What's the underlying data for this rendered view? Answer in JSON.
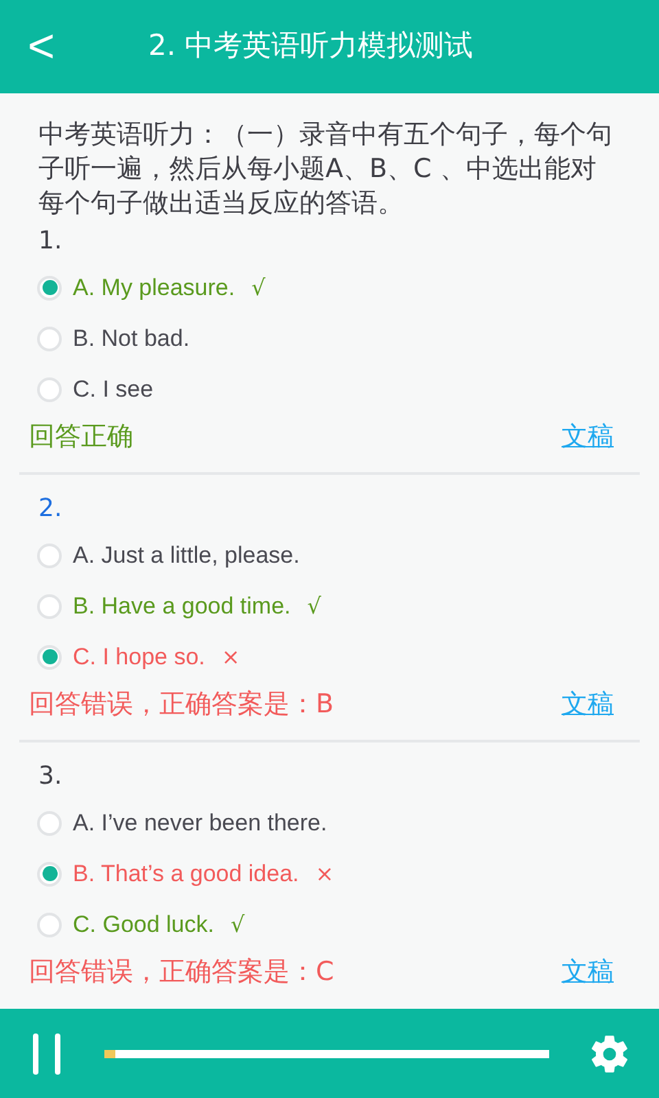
{
  "header": {
    "back": "<",
    "title": "2. 中考英语听力模拟测试"
  },
  "instructions": "中考英语听力：（一）录音中有五个句子，每个句子听一遍，然后从每小题A、B、C 、中选出能对每个句子做出适当反应的答语。",
  "questions": [
    {
      "number": "1.",
      "playing": false,
      "options": [
        {
          "label": "A. My pleasure.",
          "mark": "√",
          "selected": true,
          "answer": true
        },
        {
          "label": "B. Not bad.",
          "selected": false,
          "answer": false
        },
        {
          "label": "C. I see",
          "selected": false,
          "answer": false
        }
      ],
      "result": {
        "text": "回答正确",
        "correct": true
      },
      "transcript_link": "文稿"
    },
    {
      "number": "2.",
      "playing": true,
      "options": [
        {
          "label": "A. Just a little, please.",
          "selected": false,
          "answer": false
        },
        {
          "label": "B. Have a good time.",
          "mark": "√",
          "selected": false,
          "answer": true
        },
        {
          "label": "C. I hope so.",
          "mark": "×",
          "selected": true,
          "answer": false
        }
      ],
      "result": {
        "text": "回答错误，正确答案是：B",
        "correct": false
      },
      "transcript_link": "文稿"
    },
    {
      "number": "3.",
      "playing": false,
      "options": [
        {
          "label": "A. I’ve never been there.",
          "selected": false,
          "answer": false
        },
        {
          "label": "B. That’s a good idea.",
          "mark": "×",
          "selected": true,
          "answer": false
        },
        {
          "label": "C. Good luck.",
          "mark": "√",
          "selected": false,
          "answer": true
        }
      ],
      "result": {
        "text": "回答错误，正确答案是：C",
        "correct": false
      },
      "transcript_link": "文稿"
    }
  ],
  "player": {
    "playing": true,
    "level": 0.025
  }
}
